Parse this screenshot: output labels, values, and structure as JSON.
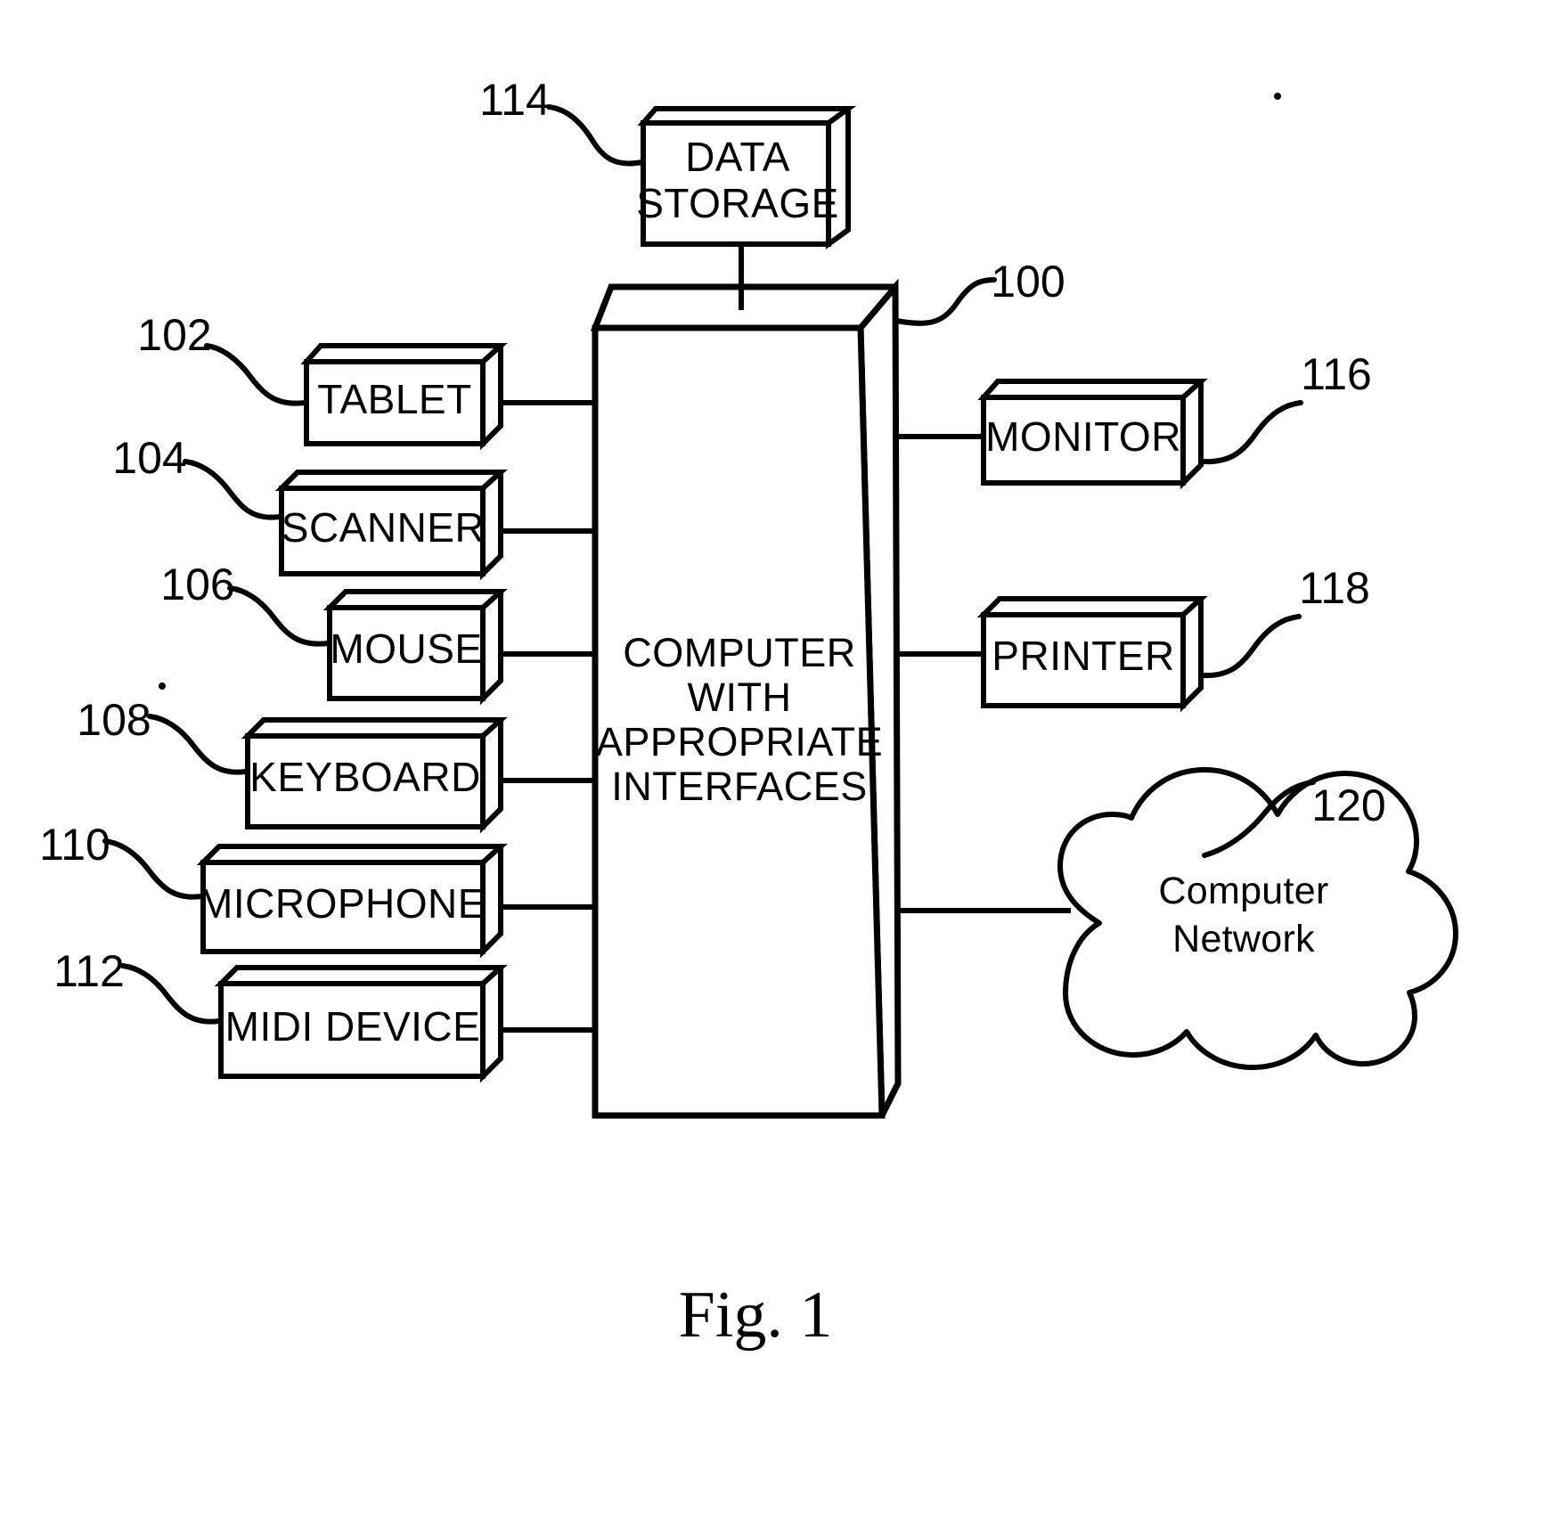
{
  "figure": {
    "caption": "Fig. 1",
    "title": "Computer system block diagram"
  },
  "central": {
    "ref": "100",
    "label_lines": [
      "COMPUTER",
      "WITH",
      "APPROPRIATE",
      "INTERFACES"
    ]
  },
  "top_device": {
    "ref": "114",
    "label_lines": [
      "DATA",
      "STORAGE"
    ]
  },
  "input_devices": [
    {
      "ref": "102",
      "label": "TABLET"
    },
    {
      "ref": "104",
      "label": "SCANNER"
    },
    {
      "ref": "106",
      "label": "MOUSE"
    },
    {
      "ref": "108",
      "label": "KEYBOARD"
    },
    {
      "ref": "110",
      "label": "MICROPHONE"
    },
    {
      "ref": "112",
      "label": "MIDI DEVICE"
    }
  ],
  "output_devices": [
    {
      "ref": "116",
      "label": "MONITOR"
    },
    {
      "ref": "118",
      "label": "PRINTER"
    }
  ],
  "network": {
    "ref": "120",
    "label_lines": [
      "Computer",
      "Network"
    ]
  },
  "colors": {
    "line": "#000000",
    "fill": "#ffffff",
    "background": "#ffffff"
  }
}
